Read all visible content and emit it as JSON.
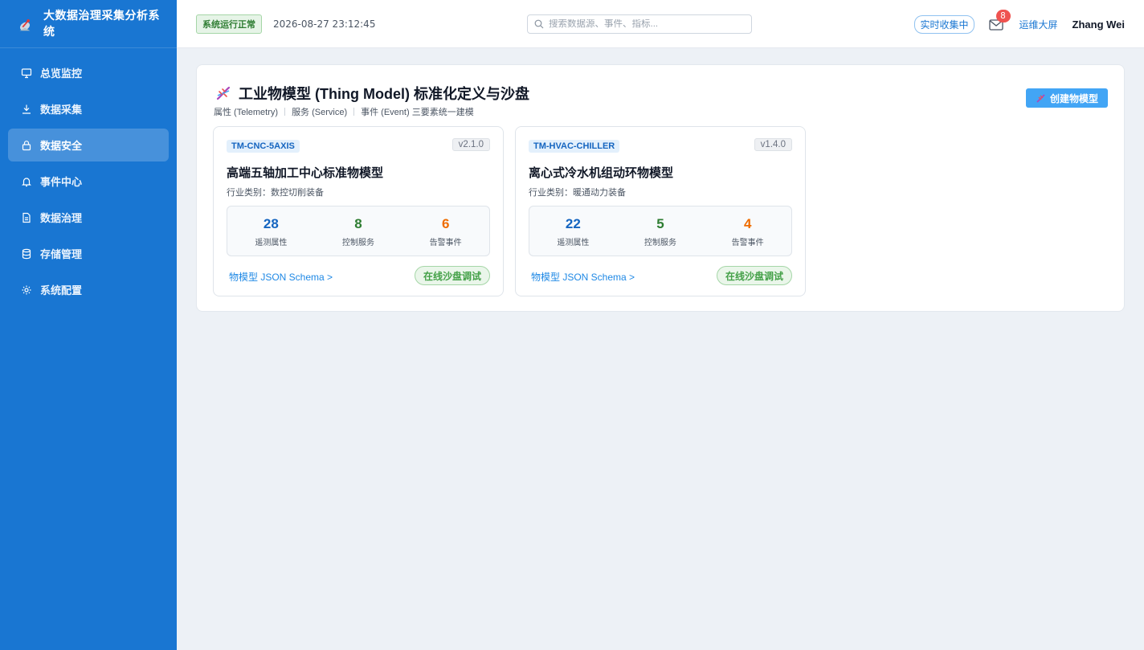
{
  "app": {
    "title": "大数据治理采集分析系统"
  },
  "sidebar": {
    "items": [
      {
        "label": "总览监控",
        "icon": "monitor-icon",
        "active": false
      },
      {
        "label": "数据采集",
        "icon": "download-icon",
        "active": false
      },
      {
        "label": "数据安全",
        "icon": "lock-icon",
        "active": true
      },
      {
        "label": "事件中心",
        "icon": "bell-icon",
        "active": false
      },
      {
        "label": "数据治理",
        "icon": "document-icon",
        "active": false
      },
      {
        "label": "存储管理",
        "icon": "database-icon",
        "active": false
      },
      {
        "label": "系统配置",
        "icon": "gear-icon",
        "active": false
      }
    ]
  },
  "header": {
    "status": "系统运行正常",
    "datetime": "2026-08-27 23:12:45",
    "search_placeholder": "搜索数据源、事件、指标...",
    "live_label": "实时收集中",
    "mail_count": "8",
    "ops_link": "运维大屏",
    "user": "Zhang Wei"
  },
  "panel": {
    "title": "工业物模型 (Thing Model) 标准化定义与沙盘",
    "subtitle": [
      "属性 (Telemetry)",
      "服务 (Service)",
      "事件 (Event) 三要素统一建模"
    ],
    "create_button": "创建物模型",
    "cards": [
      {
        "code": "TM-CNC-5AXIS",
        "version": "v2.1.0",
        "name": "高端五轴加工中心标准物模型",
        "category": "行业类别：数控切削装备",
        "stats": [
          {
            "value": "28",
            "label": "遥测属性"
          },
          {
            "value": "8",
            "label": "控制服务"
          },
          {
            "value": "6",
            "label": "告警事件"
          }
        ],
        "schema_link": "物模型 JSON Schema >",
        "sandbox_button": "在线沙盘调试"
      },
      {
        "code": "TM-HVAC-CHILLER",
        "version": "v1.4.0",
        "name": "离心式冷水机组动环物模型",
        "category": "行业类别：暖通动力装备",
        "stats": [
          {
            "value": "22",
            "label": "遥测属性"
          },
          {
            "value": "5",
            "label": "控制服务"
          },
          {
            "value": "4",
            "label": "告警事件"
          }
        ],
        "schema_link": "物模型 JSON Schema >",
        "sandbox_button": "在线沙盘调试"
      }
    ]
  },
  "colors": {
    "sidebar": "#1976d2",
    "accent": "#42a5f5",
    "success": "#2e7d32",
    "warning": "#ef6c00",
    "danger": "#ef5350"
  }
}
